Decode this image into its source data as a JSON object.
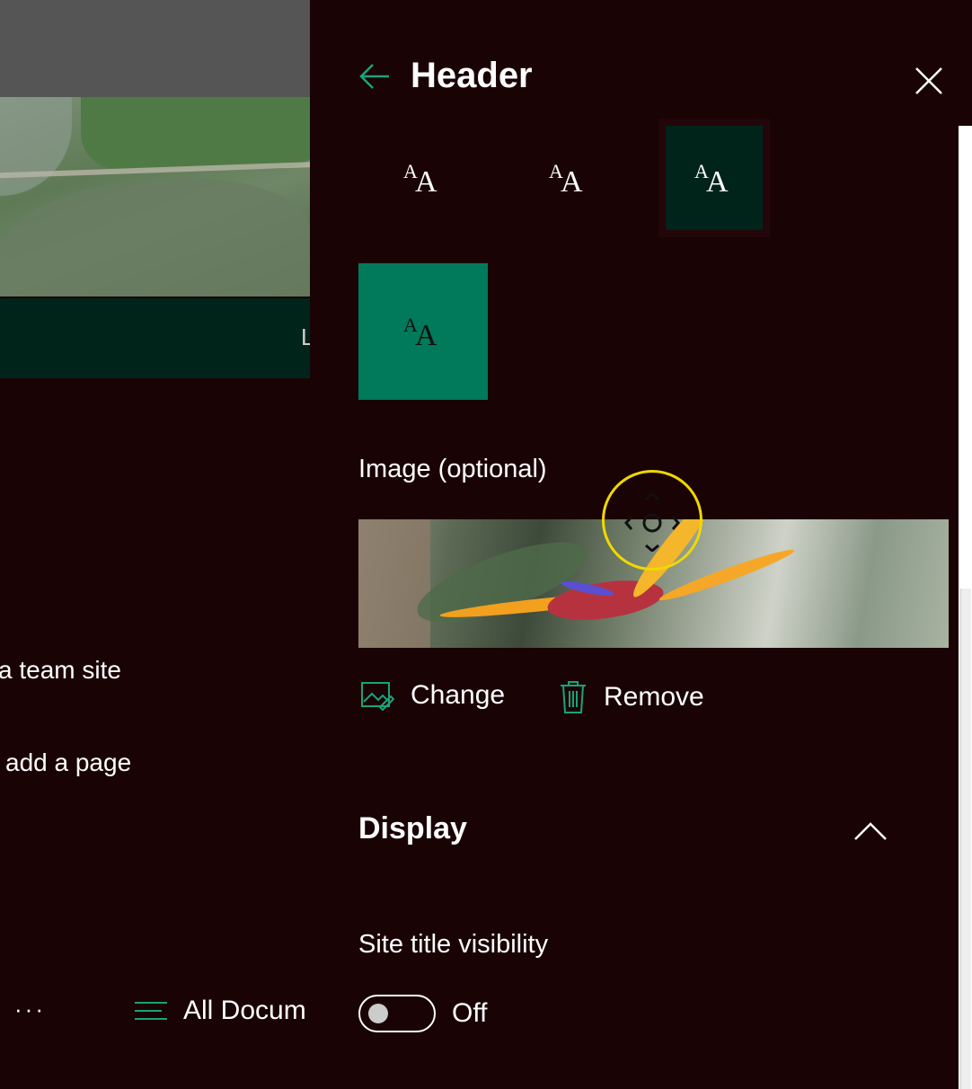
{
  "left": {
    "partial_text": "L",
    "links": [
      "a team site",
      "add a page"
    ],
    "more_label": "···",
    "all_documents": "All Docum"
  },
  "panel": {
    "title": "Header",
    "image_label": "Image (optional)",
    "change_label": "Change",
    "remove_label": "Remove",
    "display_title": "Display",
    "site_title_visibility_label": "Site title visibility",
    "toggle_state": "Off"
  },
  "colors": {
    "background": "#1a0305",
    "accent": "#007a5a",
    "selected_tile": "#00241a"
  }
}
